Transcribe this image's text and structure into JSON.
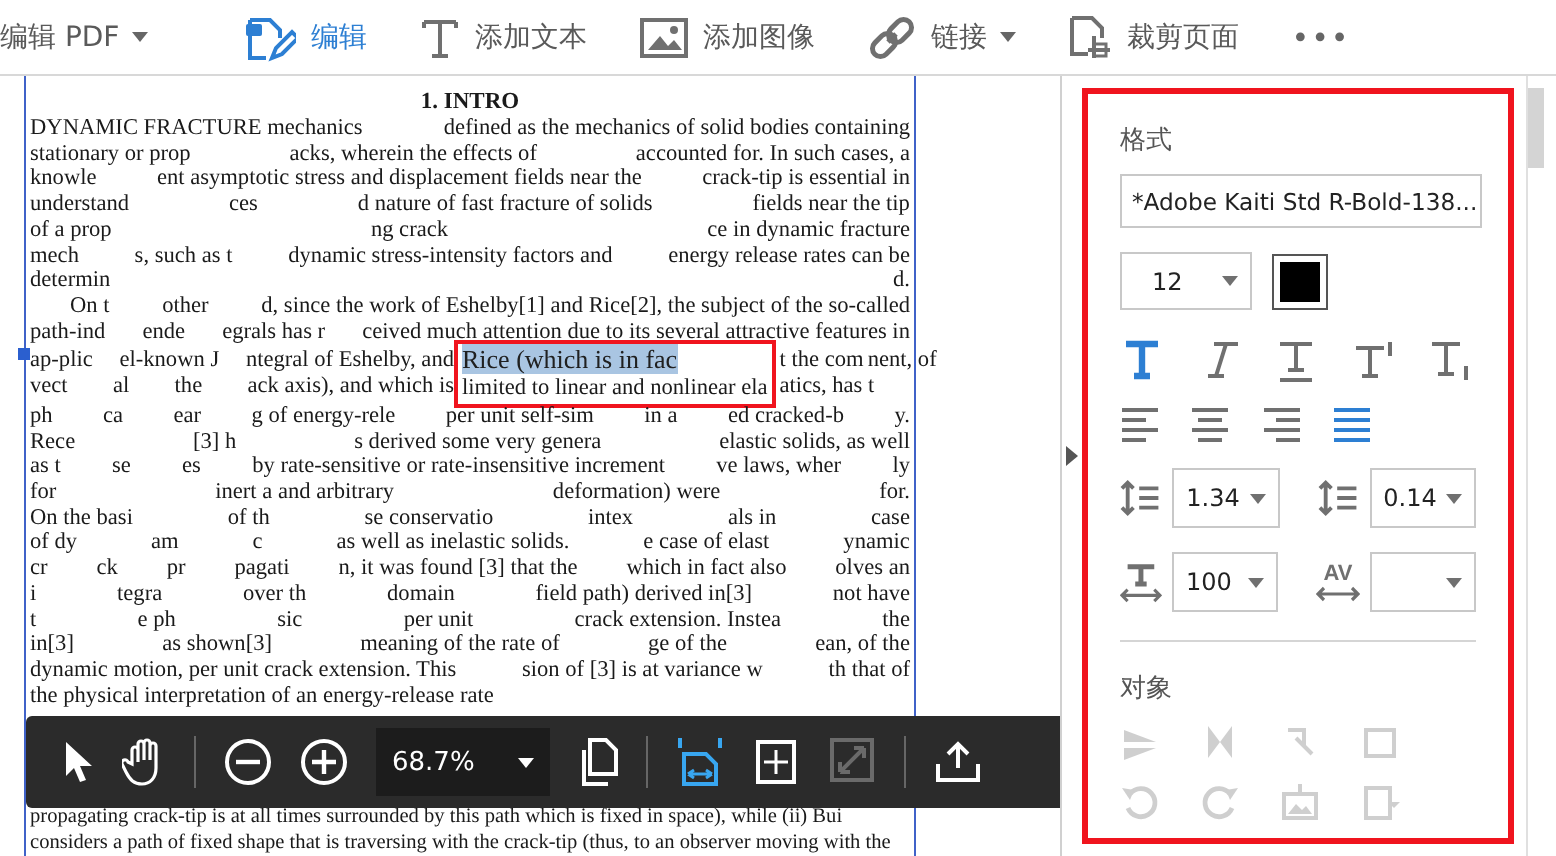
{
  "toolbar": {
    "items": [
      {
        "label": "编辑 PDF",
        "dropdown": true,
        "selected": false
      },
      {
        "label": "编辑",
        "dropdown": false,
        "selected": true
      },
      {
        "label": "添加文本",
        "dropdown": false,
        "selected": false
      },
      {
        "label": "添加图像",
        "dropdown": false,
        "selected": false
      },
      {
        "label": "链接",
        "dropdown": true,
        "selected": false
      },
      {
        "label": "裁剪页面",
        "dropdown": false,
        "selected": false
      }
    ],
    "more": "•••"
  },
  "document": {
    "heading": "1. INTRO",
    "lines": [
      {
        "kind": "line",
        "indent": false,
        "parts": [
          "DYNAMIC FRACTURE mechanics",
          "defined as the mechanics of solid bodies containing"
        ]
      },
      {
        "kind": "line",
        "indent": false,
        "parts": [
          "stationary or prop",
          "acks, wherein the effects of",
          "accounted for. In such cases, a"
        ]
      },
      {
        "kind": "line",
        "indent": false,
        "parts": [
          "knowle",
          "ent asymptotic stress and displacement fields near the",
          "crack-tip is essential in"
        ]
      },
      {
        "kind": "line",
        "indent": false,
        "parts": [
          "understand",
          "ces",
          "d nature of fast fracture of solids",
          "fields near the tip"
        ]
      },
      {
        "kind": "line",
        "indent": false,
        "parts": [
          "of a prop",
          "ng crack",
          "ce in dynamic fracture"
        ]
      },
      {
        "kind": "line",
        "indent": false,
        "parts": [
          "mech",
          "s, such as t",
          "dynamic stress-intensity factors and",
          "energy release rates can be"
        ]
      },
      {
        "kind": "line",
        "indent": false,
        "parts": [
          "determin",
          "d."
        ]
      },
      {
        "kind": "line",
        "indent": true,
        "parts": [
          "On t",
          "other",
          "d, since the work of Eshelby[1] and Rice[2], the subject of the so-called"
        ]
      },
      {
        "kind": "line",
        "indent": false,
        "parts": [
          "path-ind",
          "ende",
          "egrals has r",
          "ceived much attention due to its several attractive features in"
        ]
      },
      {
        "kind": "framed",
        "indent": false,
        "left": [
          [
            "ap-plic",
            "el-known J",
            "ntegral of Eshelby, and"
          ],
          [
            "vect",
            "al",
            "the",
            "ack axis), and which is"
          ]
        ],
        "selection": "Rice (which is in fac",
        "inside": "limited to linear and nonlinear ela",
        "right": [
          [
            "t the com",
            "nent, of"
          ],
          [
            "atics, has t"
          ]
        ]
      },
      {
        "kind": "line",
        "indent": false,
        "parts": [
          "ph",
          "ca",
          "ear",
          "g of energy-rele",
          "per unit self-sim",
          "in a",
          "ed cracked-b",
          "y."
        ]
      },
      {
        "kind": "line",
        "indent": false,
        "parts": [
          "Rece",
          "[3] h",
          "s derived some very genera",
          "elastic solids, as well"
        ]
      },
      {
        "kind": "line",
        "indent": false,
        "parts": [
          "as t",
          "se",
          "es",
          "by rate-sensitive or rate-insensitive increment",
          "ve laws, wher",
          "ly"
        ]
      },
      {
        "kind": "line",
        "indent": false,
        "parts": [
          "for",
          "inert a and arbitrary",
          "deformation) were",
          "for."
        ]
      },
      {
        "kind": "line",
        "indent": false,
        "parts": [
          "On the basi",
          "of th",
          "se conservatio",
          "intex",
          "als in",
          "case"
        ]
      },
      {
        "kind": "line",
        "indent": false,
        "parts": [
          "of dy",
          "am",
          "c",
          "as well as inelastic solids.",
          "e case of elast",
          "ynamic"
        ]
      },
      {
        "kind": "line",
        "indent": false,
        "parts": [
          "cr",
          "ck",
          "pr",
          "pagati",
          "n, it was found [3] that the",
          "which in fact also",
          "olves an"
        ]
      },
      {
        "kind": "line",
        "indent": false,
        "parts": [
          "i",
          "tegra",
          "over th",
          "domain",
          "field path) derived in[3]",
          "not have"
        ]
      },
      {
        "kind": "line",
        "indent": false,
        "parts": [
          "t",
          "e ph",
          "sic",
          "per unit",
          "crack extension. Instea",
          "the"
        ]
      },
      {
        "kind": "line",
        "indent": false,
        "parts": [
          "in[3]",
          "as shown[3]",
          "meaning of the rate of",
          "ge of the",
          "ean, of the"
        ]
      },
      {
        "kind": "line",
        "indent": false,
        "parts": [
          "dynamic motion, per unit crack extension. This",
          "sion of [3] is at variance w",
          "th that of"
        ]
      },
      {
        "kind": "line",
        "indent": false,
        "parts": [
          "the physical interpretation of an energy-release rate"
        ]
      }
    ],
    "lines_below": [
      {
        "kind": "line",
        "indent": false,
        "parts": [
          "propagating crack-tip is at all times surrounded by this path which is fixed in space), while (ii) Bui"
        ]
      },
      {
        "kind": "line",
        "indent": false,
        "parts": [
          "considers a path of fixed shape that is traversing with the crack-tip (thus, to an observer moving with the"
        ]
      }
    ]
  },
  "float_bar": {
    "zoom": "68.7%",
    "view_buttons": [
      {
        "selected": true,
        "disabled": false
      },
      {
        "selected": false,
        "disabled": false
      },
      {
        "selected": false,
        "disabled": true
      }
    ]
  },
  "format_panel": {
    "heading": "格式",
    "font": "*Adobe Kaiti Std R-Bold-138...",
    "size": "12",
    "color": "#000000",
    "style_buttons": [
      {
        "selected": true
      },
      {
        "selected": false
      },
      {
        "selected": false
      },
      {
        "selected": false
      },
      {
        "selected": false
      }
    ],
    "align_buttons": [
      {
        "selected": false
      },
      {
        "selected": false
      },
      {
        "selected": false
      },
      {
        "selected": true
      }
    ],
    "spacing_fields": [
      {
        "value": "1.34"
      },
      {
        "value": "0.14"
      },
      {
        "value": "100"
      },
      {
        "icon_label": "AV"
      }
    ],
    "object_heading": "对象",
    "object_tools": [
      {
        "disabled": true
      },
      {
        "disabled": true
      },
      {
        "disabled": true
      },
      {
        "disabled": true
      },
      {
        "disabled": true
      },
      {
        "disabled": true
      },
      {
        "disabled": true
      },
      {
        "disabled": true
      }
    ]
  }
}
